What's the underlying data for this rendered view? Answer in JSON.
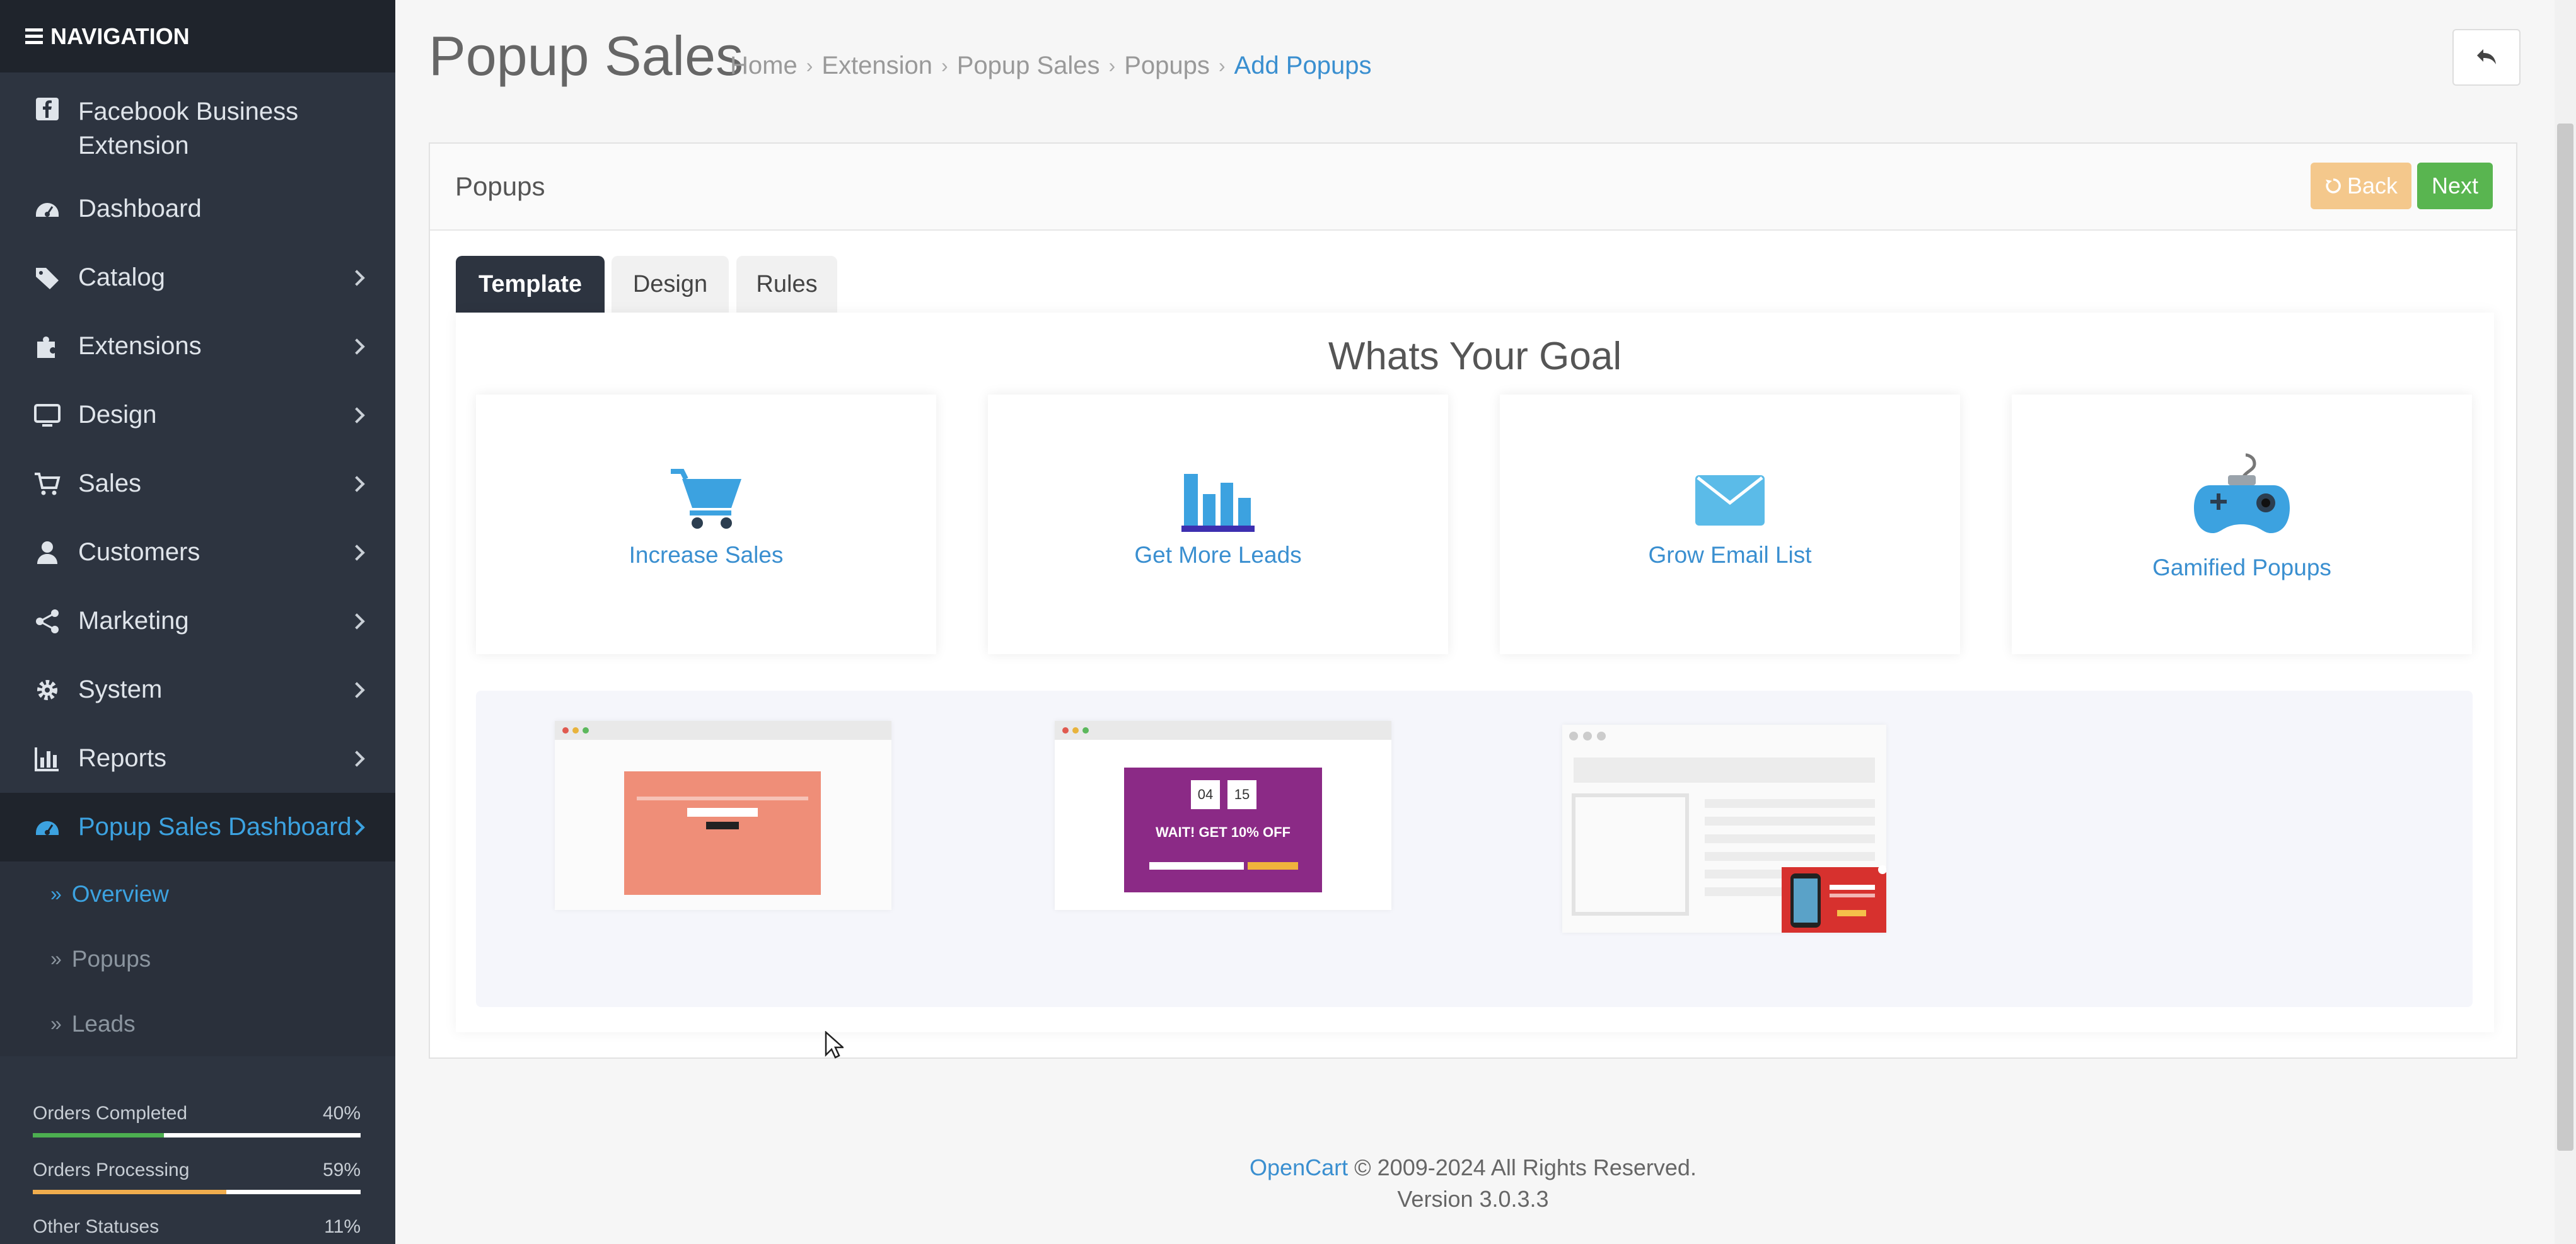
{
  "sidebar": {
    "header": "NAVIGATION",
    "items": [
      {
        "label": "Facebook Business Extension",
        "icon": "facebook-icon"
      },
      {
        "label": "Dashboard",
        "icon": "dashboard-icon"
      },
      {
        "label": "Catalog",
        "icon": "tags-icon"
      },
      {
        "label": "Extensions",
        "icon": "puzzle-icon"
      },
      {
        "label": "Design",
        "icon": "monitor-icon"
      },
      {
        "label": "Sales",
        "icon": "cart-icon"
      },
      {
        "label": "Customers",
        "icon": "user-icon"
      },
      {
        "label": "Marketing",
        "icon": "share-icon"
      },
      {
        "label": "System",
        "icon": "gear-icon"
      },
      {
        "label": "Reports",
        "icon": "bar-chart-icon"
      },
      {
        "label": "Popup Sales Dashboard",
        "icon": "dashboard-icon"
      }
    ],
    "sub_items": [
      {
        "label": "Overview"
      },
      {
        "label": "Popups"
      },
      {
        "label": "Leads"
      }
    ],
    "stats": [
      {
        "label": "Orders Completed",
        "value": "40%",
        "fraction": 0.4,
        "color": "#4caf50"
      },
      {
        "label": "Orders Processing",
        "value": "59%",
        "fraction": 0.59,
        "color": "#f0ad4e"
      },
      {
        "label": "Other Statuses",
        "value": "11%",
        "fraction": 0.11,
        "color": "#d9534f"
      }
    ]
  },
  "header": {
    "title": "Popup Sales",
    "breadcrumb": [
      "Home",
      "Extension",
      "Popup Sales",
      "Popups",
      "Add Popups"
    ]
  },
  "panel": {
    "title": "Popups",
    "back_label": "Back",
    "next_label": "Next"
  },
  "tabs": [
    "Template",
    "Design",
    "Rules"
  ],
  "goal_title": "Whats Your Goal",
  "goals": [
    {
      "label": "Increase Sales",
      "icon": "shopping-cart-icon"
    },
    {
      "label": "Get More Leads",
      "icon": "bar-chart-icon"
    },
    {
      "label": "Grow Email List",
      "icon": "envelope-icon"
    },
    {
      "label": "Gamified Popups",
      "icon": "gamepad-icon"
    }
  ],
  "templates": [
    {
      "preview": "WAIT! GET 10% OFF",
      "countdown": [
        "04",
        "15"
      ]
    }
  ],
  "footer": {
    "brand": "OpenCart",
    "copyright": "© 2009-2024 All Rights Reserved.",
    "version": "Version 3.0.3.3"
  },
  "colors": {
    "sidebar_bg": "#2d3440",
    "accent": "#3ca2e0",
    "next_button": "#59b550",
    "back_button": "#f4c88c"
  }
}
